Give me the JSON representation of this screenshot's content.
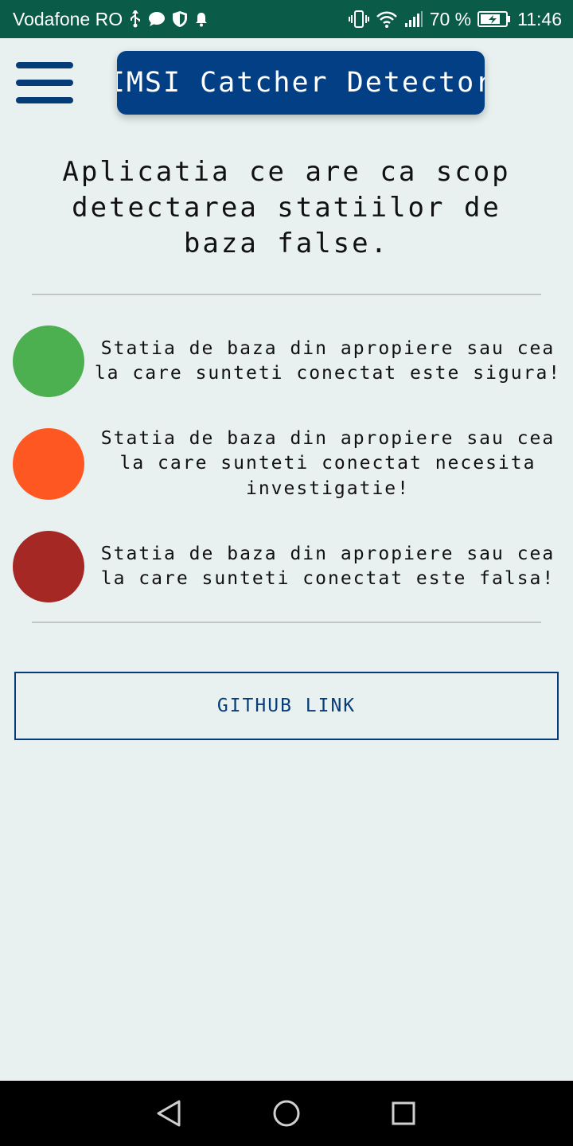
{
  "status_bar": {
    "carrier": "Vodafone RO",
    "battery": "70 %",
    "time": "11:46",
    "left_icons": [
      "usb-icon",
      "chat-icon",
      "shield-icon",
      "bell-icon"
    ],
    "right_icons": [
      "vibrate-icon",
      "wifi-icon",
      "signal-icon",
      "battery-icon"
    ]
  },
  "header": {
    "menu_icon": "hamburger-menu-icon",
    "title": "IMSI Catcher Detector"
  },
  "subtitle": "Aplicatia ce are ca scop detectarea statiilor de baza false.",
  "legend": [
    {
      "color": "#4caf50",
      "text": "Statia de baza din apropiere sau cea la care sunteti conectat este sigura!"
    },
    {
      "color": "#ff5722",
      "text": "Statia de baza din apropiere sau cea la care sunteti conectat necesita investigatie!"
    },
    {
      "color": "#a52824",
      "text": "Statia de baza din apropiere sau cea la care sunteti conectat este falsa!"
    }
  ],
  "github_button": {
    "label": "GITHUB LINK"
  },
  "nav_bar": {
    "buttons": [
      "back-icon",
      "home-icon",
      "recents-icon"
    ]
  },
  "colors": {
    "status_bar": "#0a5b48",
    "accent": "#033f85",
    "background": "#e8f1f0"
  }
}
